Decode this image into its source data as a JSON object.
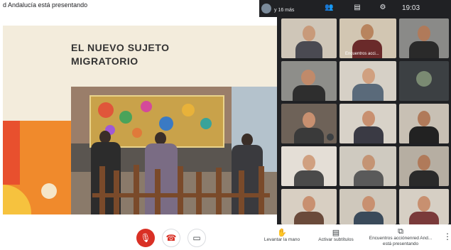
{
  "header": {
    "presenting_text": "d Andalucía está presentando",
    "more_text": "y 16 más",
    "clock": "19:03"
  },
  "presentation": {
    "title": "EL NUEVO SUJETO\nMIGRATORIO"
  },
  "tiles": [
    {
      "name": ""
    },
    {
      "name": ""
    },
    {
      "name": "Encuentros acci..."
    },
    {
      "name": ""
    },
    {
      "name": ""
    },
    {
      "name": ""
    },
    {
      "name": ""
    },
    {
      "name": ""
    },
    {
      "name": ""
    },
    {
      "name": ""
    },
    {
      "name": ""
    },
    {
      "name": ""
    },
    {
      "name": ""
    },
    {
      "name": ""
    },
    {
      "name": ""
    },
    {
      "name": ""
    },
    {
      "name": ""
    },
    {
      "name": ""
    },
    {
      "name": ""
    }
  ],
  "controls": {
    "raise_hand": "Levantar la mano",
    "captions": "Activar subtítulos",
    "presenting_line1": "Encuentros acciónenred And...",
    "presenting_line2": "está presentando"
  },
  "colors": {
    "end_call": "#ffffff",
    "mic_off": "#d93025",
    "accent_orange": "#f08a2c"
  },
  "icons": [
    "mic-off-icon",
    "end-call-icon",
    "camera-icon",
    "raise-hand-icon",
    "captions-icon",
    "present-icon",
    "more-vert-icon"
  ]
}
